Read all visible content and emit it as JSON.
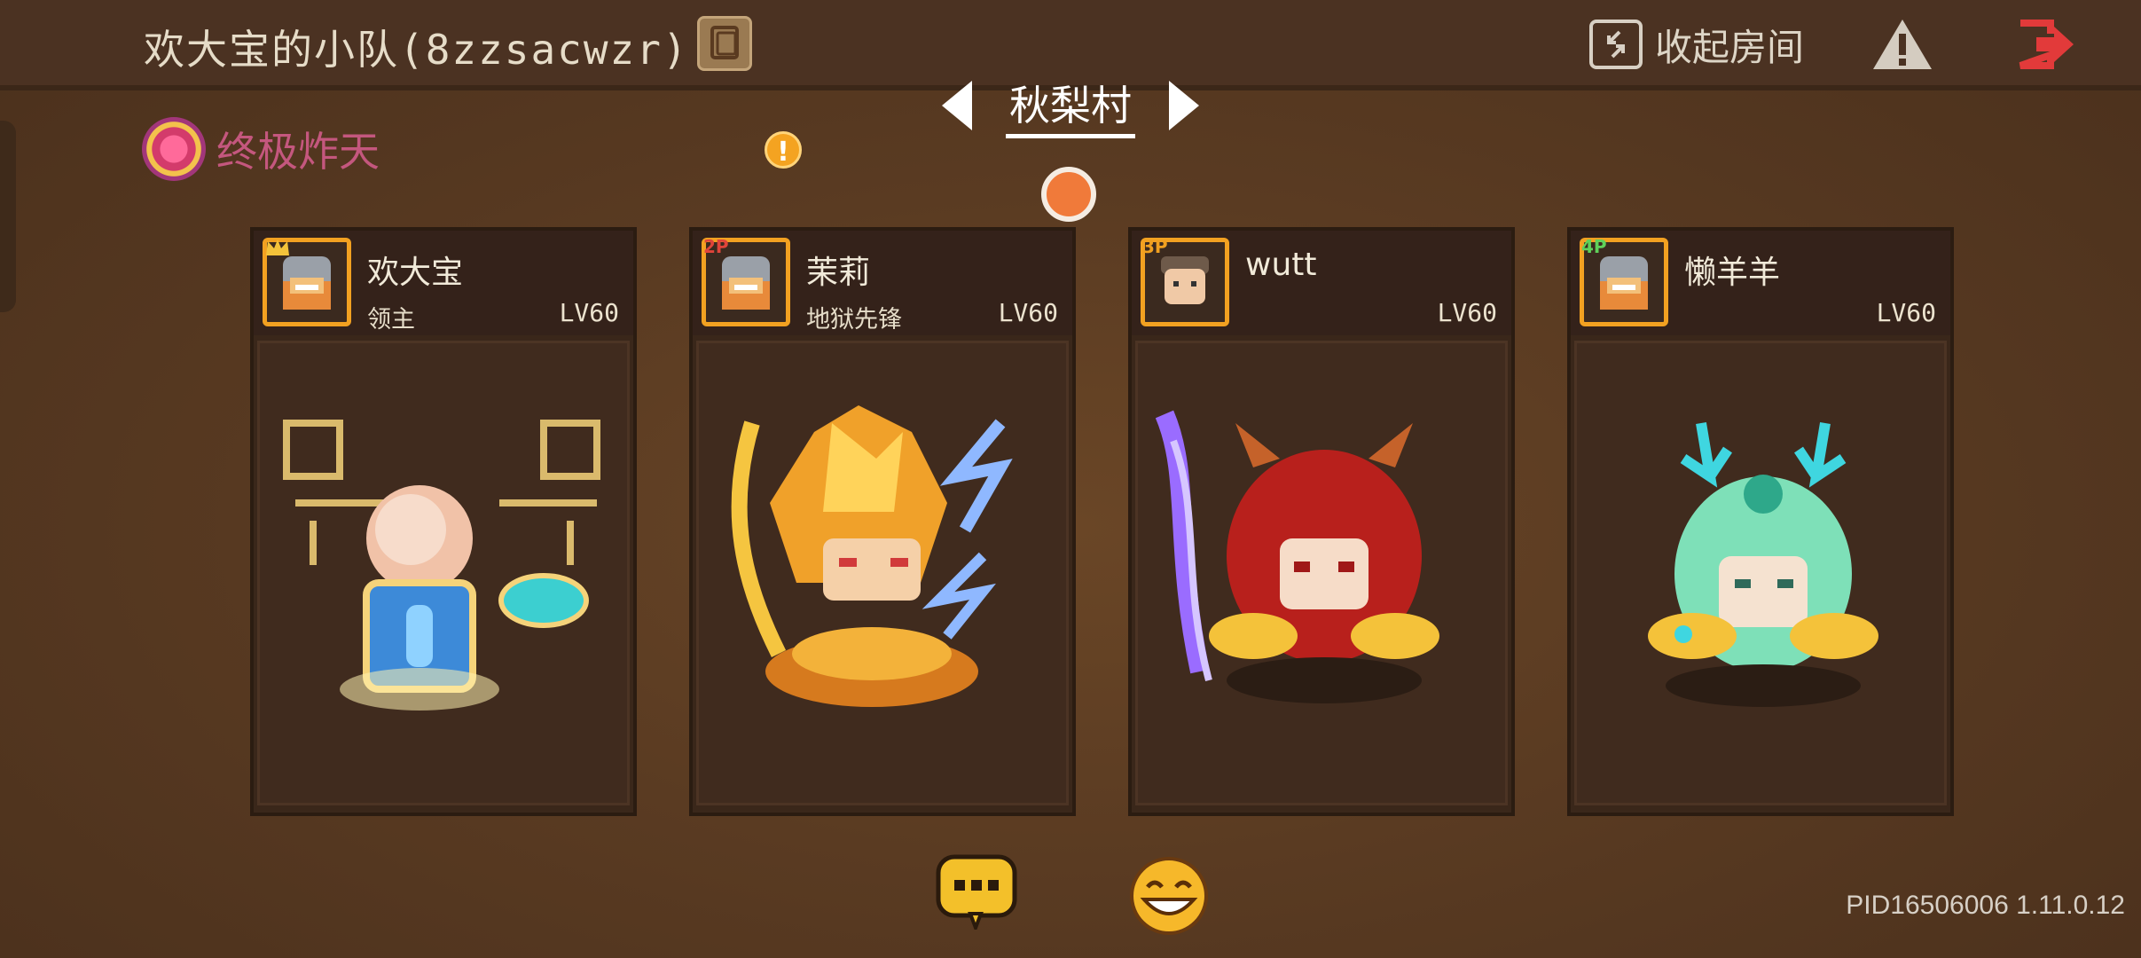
{
  "header": {
    "room_title": "欢大宝的小队(8zzsacwzr)",
    "collapse_label": "收起房间",
    "icons": [
      "copy-icon",
      "collapse-room-icon",
      "warning-icon",
      "exit-icon"
    ]
  },
  "map": {
    "name": "秋梨村"
  },
  "mode": {
    "label": "终极炸天"
  },
  "players": [
    {
      "name": "欢大宝",
      "title": "领主",
      "level": "LV60",
      "badge": "",
      "badge_icon": "crown-icon",
      "badge_color": "#f3c23a"
    },
    {
      "name": "茉莉",
      "title": "地狱先锋",
      "level": "LV60",
      "badge": "2P",
      "badge_color": "#e0443a"
    },
    {
      "name": "wutt",
      "title": "",
      "level": "LV60",
      "badge": "3P",
      "badge_color": "#f0a020"
    },
    {
      "name": "懒羊羊",
      "title": "",
      "level": "LV60",
      "badge": "4P",
      "badge_color": "#5fd15a"
    }
  ],
  "footer": {
    "pid_version": "PID16506006 1.11.0.12"
  },
  "colors": {
    "accent": "#f2a121",
    "map_dot": "#f07a3a",
    "exit": "#e23a3a"
  }
}
